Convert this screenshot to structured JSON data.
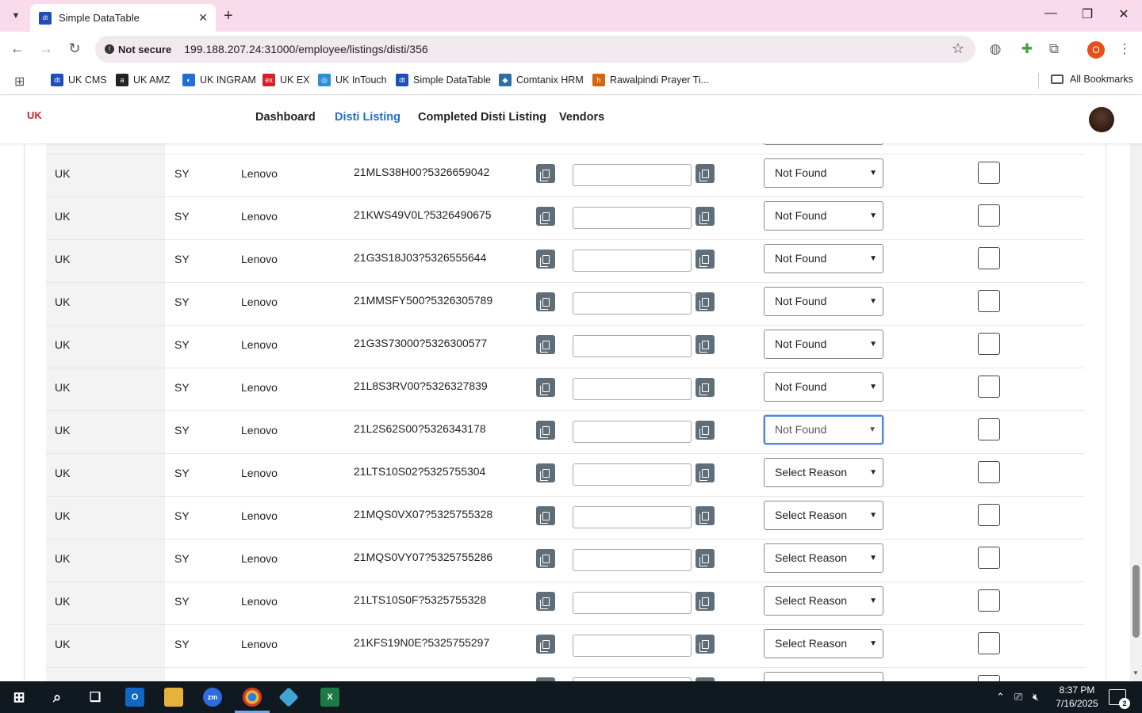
{
  "browser": {
    "tab_title": "Simple DataTable",
    "tab_icon_text": "dt",
    "url": "199.188.207.24:31000/employee/listings/disti/356",
    "security_label": "Not secure",
    "profile_initial": "O"
  },
  "bookmarks": [
    {
      "label": "UK CMS",
      "color": "#1d4fb8",
      "icon": "dt"
    },
    {
      "label": "UK AMZ",
      "color": "#222222",
      "icon": "a"
    },
    {
      "label": "UK INGRAM",
      "color": "#1f6fd6",
      "icon": "◐"
    },
    {
      "label": "UK EX",
      "color": "#d3222a",
      "icon": "ex"
    },
    {
      "label": "UK InTouch",
      "color": "#2a8fd6",
      "icon": "◎"
    },
    {
      "label": "Simple DataTable",
      "color": "#1d4fb8",
      "icon": "dt"
    },
    {
      "label": "Comtanix HRM",
      "color": "#2c6ea8",
      "icon": "◆"
    },
    {
      "label": "Rawalpindi Prayer Ti...",
      "color": "#d4660f",
      "icon": "h"
    }
  ],
  "all_bookmarks_label": "All Bookmarks",
  "nav": {
    "logo_text": "UK",
    "links": [
      "Dashboard",
      "Disti Listing",
      "Completed Disti Listing",
      "Vendors"
    ],
    "active": "Disti Listing"
  },
  "table": {
    "rows": [
      {
        "country": "UK",
        "category": "SY",
        "brand": "Lenovo",
        "sku": "21MLS38H00?5326659042",
        "reason": "Not Found"
      },
      {
        "country": "UK",
        "category": "SY",
        "brand": "Lenovo",
        "sku": "21KWS49V0L?5326490675",
        "reason": "Not Found"
      },
      {
        "country": "UK",
        "category": "SY",
        "brand": "Lenovo",
        "sku": "21G3S18J03?5326555644",
        "reason": "Not Found"
      },
      {
        "country": "UK",
        "category": "SY",
        "brand": "Lenovo",
        "sku": "21MMSFY500?5326305789",
        "reason": "Not Found"
      },
      {
        "country": "UK",
        "category": "SY",
        "brand": "Lenovo",
        "sku": "21G3S73000?5326300577",
        "reason": "Not Found"
      },
      {
        "country": "UK",
        "category": "SY",
        "brand": "Lenovo",
        "sku": "21L8S3RV00?5326327839",
        "reason": "Not Found"
      },
      {
        "country": "UK",
        "category": "SY",
        "brand": "Lenovo",
        "sku": "21L2S62S00?5326343178",
        "reason": "Not Found"
      },
      {
        "country": "UK",
        "category": "SY",
        "brand": "Lenovo",
        "sku": "21LTS10S02?5325755304",
        "reason": "Select Reason"
      },
      {
        "country": "UK",
        "category": "SY",
        "brand": "Lenovo",
        "sku": "21MQS0VX07?5325755328",
        "reason": "Select Reason"
      },
      {
        "country": "UK",
        "category": "SY",
        "brand": "Lenovo",
        "sku": "21MQS0VY07?5325755286",
        "reason": "Select Reason"
      },
      {
        "country": "UK",
        "category": "SY",
        "brand": "Lenovo",
        "sku": "21LTS10S0F?5325755328",
        "reason": "Select Reason"
      },
      {
        "country": "UK",
        "category": "SY",
        "brand": "Lenovo",
        "sku": "21KFS19N0E?5325755297",
        "reason": "Select Reason"
      }
    ],
    "focused_row": 6
  },
  "taskbar": {
    "time": "8:37 PM",
    "date": "7/16/2025",
    "notifications": "2"
  }
}
